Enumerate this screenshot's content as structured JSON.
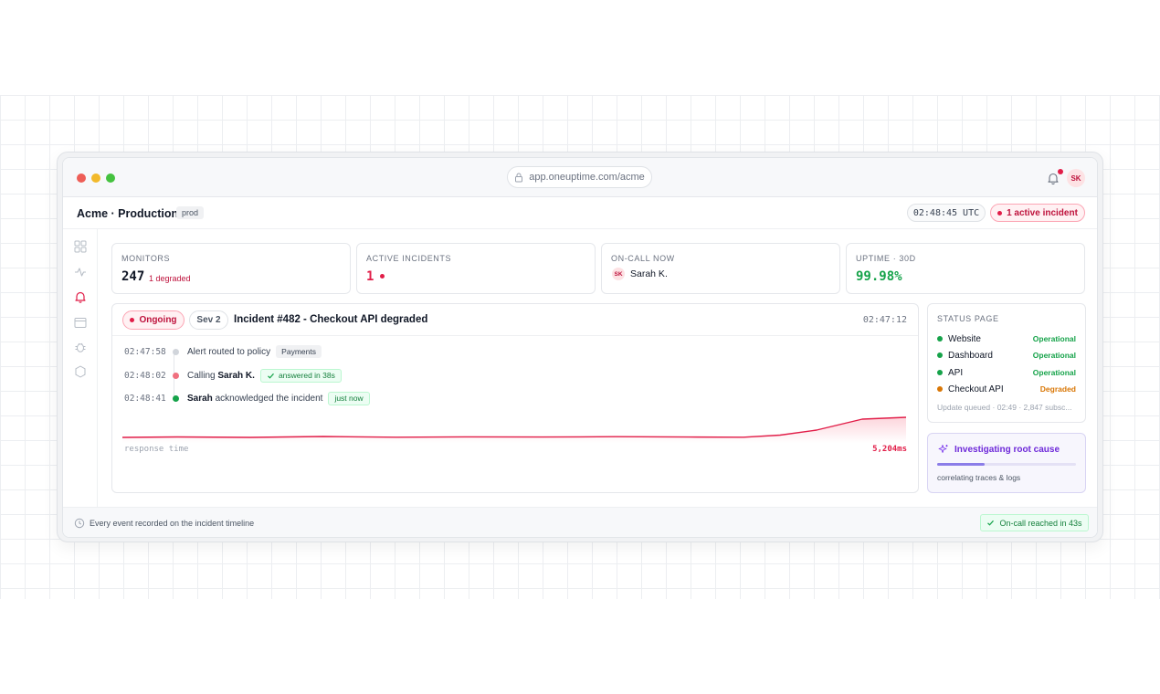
{
  "browser": {
    "url": "app.oneuptime.com/acme",
    "avatar_initials": "SK"
  },
  "header": {
    "project_title": "Acme · Production",
    "env_tag": "prod",
    "clock": "02:48:45 UTC",
    "incident_pill": "1 active incident"
  },
  "sidebar": {
    "items": [
      "dashboard-icon",
      "activity-icon",
      "bell-icon",
      "calendar-icon",
      "bug-icon",
      "settings-icon"
    ]
  },
  "stats": {
    "monitors": {
      "label": "MONITORS",
      "value": "247",
      "sub": "1 degraded"
    },
    "active_incidents": {
      "label": "ACTIVE INCIDENTS",
      "value": "1"
    },
    "on_call": {
      "label": "ON-CALL NOW",
      "initials": "SK",
      "name": "Sarah K."
    },
    "uptime": {
      "label": "UPTIME · 30D",
      "value": "99.98%"
    }
  },
  "incident": {
    "status": "Ongoing",
    "severity": "Sev 2",
    "title": "Incident #482 - Checkout API degraded",
    "time": "02:47:12",
    "timeline": [
      {
        "time": "02:47:58",
        "text": "Alert routed to policy",
        "chip": "Payments",
        "dot": "#d1d5db"
      },
      {
        "time": "02:48:02",
        "text_pre": "Calling ",
        "text_bold": "Sarah K.",
        "chip": "answered in 38s",
        "dot": "#f0707f"
      },
      {
        "time": "02:48:41",
        "text_bold": "Sarah",
        "text_post": " acknowledged the incident",
        "chip": "just now",
        "dot": "#16a34a"
      }
    ],
    "chart_label": "response time",
    "chart_value": "5,204ms"
  },
  "status_page": {
    "label": "STATUS PAGE",
    "services": [
      {
        "name": "Website",
        "state": "Operational",
        "color": "#16a34a"
      },
      {
        "name": "Dashboard",
        "state": "Operational",
        "color": "#16a34a"
      },
      {
        "name": "API",
        "state": "Operational",
        "color": "#16a34a"
      },
      {
        "name": "Checkout API",
        "state": "Degraded",
        "color": "#d97706"
      }
    ],
    "footer": "Update queued · 02:49 · 2,847 subsc..."
  },
  "investigation": {
    "title": "Investigating root cause",
    "subtitle": "correlating traces & logs",
    "progress": 0.34
  },
  "footer": {
    "text": "Every event recorded on the incident timeline",
    "badge": "On-call reached in 43s"
  },
  "colors": {
    "accent_red": "#e11d48",
    "accent_green": "#16a34a",
    "accent_purple": "#6d28d9",
    "degraded": "#d97706"
  }
}
